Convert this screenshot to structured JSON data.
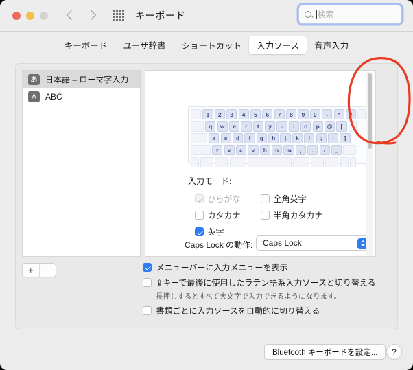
{
  "window": {
    "title": "キーボード",
    "traffic_lights": [
      "close",
      "minimize",
      "zoom-disabled"
    ],
    "nav": {
      "back": "‹",
      "forward": "›"
    },
    "grid_icon": "apps-grid-icon"
  },
  "search": {
    "placeholder": "検索",
    "value": "",
    "icon": "search-icon"
  },
  "tabs": [
    {
      "label": "キーボード",
      "selected": false
    },
    {
      "label": "ユーザ辞書",
      "selected": false
    },
    {
      "label": "ショートカット",
      "selected": false
    },
    {
      "label": "入力ソース",
      "selected": true
    },
    {
      "label": "音声入力",
      "selected": false
    }
  ],
  "sidebar": {
    "items": [
      {
        "badge": "あ",
        "label": "日本語 – ローマ字入力",
        "selected": true
      },
      {
        "badge": "A",
        "label": "ABC",
        "selected": false
      }
    ],
    "add_label": "+",
    "remove_label": "−"
  },
  "keyboard_preview": {
    "rows": [
      [
        "1",
        "2",
        "3",
        "4",
        "5",
        "6",
        "7",
        "8",
        "9",
        "0",
        "-",
        "^",
        "¥"
      ],
      [
        "q",
        "w",
        "e",
        "r",
        "t",
        "y",
        "u",
        "i",
        "o",
        "p",
        "@",
        "["
      ],
      [
        "a",
        "s",
        "d",
        "f",
        "g",
        "h",
        "j",
        "k",
        "l",
        ";",
        ":",
        "]"
      ],
      [
        "z",
        "x",
        "c",
        "v",
        "b",
        "n",
        "m",
        ",",
        ".",
        "/",
        "_"
      ]
    ]
  },
  "input_mode": {
    "label": "入力モード:",
    "options": [
      {
        "label": "ひらがな",
        "checked": true,
        "disabled": true
      },
      {
        "label": "全角英字",
        "checked": false,
        "disabled": false
      },
      {
        "label": "カタカナ",
        "checked": false,
        "disabled": false
      },
      {
        "label": "半角カタカナ",
        "checked": false,
        "disabled": false
      },
      {
        "label": "英字",
        "checked": true,
        "disabled": false
      }
    ]
  },
  "caps_lock": {
    "label": "Caps Lock の動作:",
    "value": "Caps Lock",
    "icon": "chevron-updown-icon"
  },
  "panel_options": [
    {
      "label": "メニューバーに入力メニューを表示",
      "checked": true,
      "prefix": ""
    },
    {
      "label": "キーで最後に使用したラテン語系入力ソースと切り替える",
      "checked": false,
      "prefix": "⇪"
    },
    {
      "label": "書類ごとに入力ソースを自動的に切り替える",
      "checked": false,
      "prefix": ""
    }
  ],
  "hint_text": "長押しするとすべて大文字で入力できるようになります。",
  "footer": {
    "bluetooth_button": "Bluetooth キーボードを設定...",
    "help_button": "?"
  },
  "annotation": {
    "shape": "red-ellipse-highlight",
    "color": "#ea3a21",
    "target": "vertical-scrollbar"
  },
  "scrollbar": {
    "name": "vertical-scrollbar",
    "thumb_position_percent": 0
  }
}
